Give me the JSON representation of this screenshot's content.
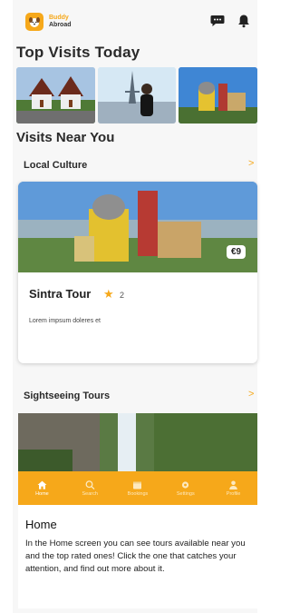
{
  "app": {
    "name_line1": "Buddy",
    "name_line2": "Abroad"
  },
  "header": {
    "chat_icon": "chat-bubble-icon",
    "bell_icon": "bell-icon"
  },
  "top_visits": {
    "title": "Top Visits Today"
  },
  "near": {
    "title": "Visits Near You",
    "sections": [
      {
        "title": "Local Culture",
        "chevron": ">"
      },
      {
        "title": "Sightseeing Tours",
        "chevron": ">"
      }
    ]
  },
  "tour_card": {
    "title": "Sintra Tour",
    "rating": "2",
    "price": "€9",
    "description": "Lorem impsum doleres et"
  },
  "nav": {
    "items": [
      {
        "label": "Home",
        "icon": "home-icon",
        "active": true
      },
      {
        "label": "Search",
        "icon": "search-icon",
        "active": false
      },
      {
        "label": "Bookings",
        "icon": "calendar-icon",
        "active": false
      },
      {
        "label": "Settings",
        "icon": "gear-icon",
        "active": false
      },
      {
        "label": "Profile",
        "icon": "person-icon",
        "active": false
      }
    ]
  },
  "tip": {
    "title": "Home",
    "body": "In the Home screen you can see tours available near you and the top rated ones! Click the one that catches your attention, and find out more about it."
  },
  "colors": {
    "accent": "#f6a81a",
    "background": "#f7f7f7"
  }
}
